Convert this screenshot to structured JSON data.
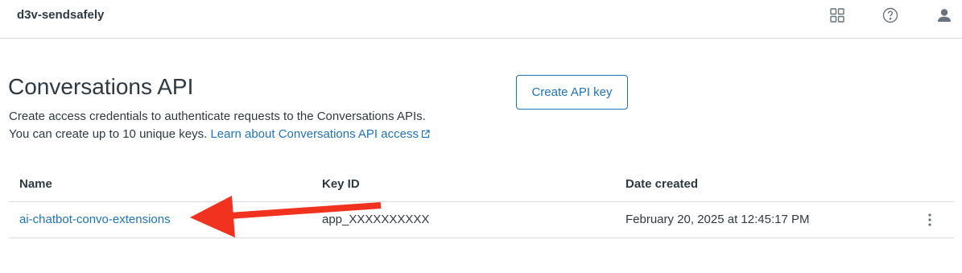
{
  "header": {
    "app_name": "d3v-sendsafely",
    "icons": [
      "apps-grid-icon",
      "help-icon",
      "user-icon"
    ]
  },
  "page": {
    "title": "Conversations API",
    "description_line1": "Create access credentials to authenticate requests to the Conversations APIs.",
    "description_line2": "You can create up to 10 unique keys.",
    "learn_link": "Learn about Conversations API access",
    "create_button": "Create API key"
  },
  "table": {
    "columns": [
      "Name",
      "Key ID",
      "Date created"
    ],
    "rows": [
      {
        "name": "ai-chatbot-convo-extensions",
        "key_id": "app_XXXXXXXXXX",
        "date_created": "February 20, 2025 at 12:45:17 PM"
      }
    ]
  },
  "colors": {
    "accent": "#1f73b7",
    "text": "#2f3941",
    "border": "#d8dcde",
    "annotation_arrow": "#f0321e"
  }
}
